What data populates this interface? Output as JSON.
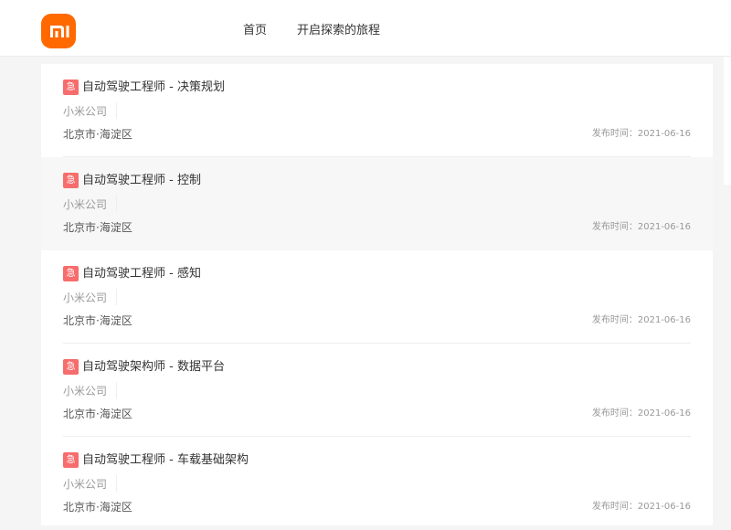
{
  "header": {
    "logo_text": "mi",
    "nav": [
      {
        "label": "首页"
      },
      {
        "label": "开启探索的旅程"
      }
    ]
  },
  "colors": {
    "brand": "#ff6900",
    "urgent_badge": "#f76c6c"
  },
  "jobs": [
    {
      "badge": "急",
      "title": "自动驾驶工程师 - 决策规划",
      "company": "小米公司",
      "location": "北京市·海淀区",
      "date_label": "发布时间：",
      "date": "2021-06-16"
    },
    {
      "badge": "急",
      "title": "自动驾驶工程师 - 控制",
      "company": "小米公司",
      "location": "北京市·海淀区",
      "date_label": "发布时间：",
      "date": "2021-06-16"
    },
    {
      "badge": "急",
      "title": "自动驾驶工程师 - 感知",
      "company": "小米公司",
      "location": "北京市·海淀区",
      "date_label": "发布时间：",
      "date": "2021-06-16"
    },
    {
      "badge": "急",
      "title": "自动驾驶架构师 - 数据平台",
      "company": "小米公司",
      "location": "北京市·海淀区",
      "date_label": "发布时间：",
      "date": "2021-06-16"
    },
    {
      "badge": "急",
      "title": "自动驾驶工程师 - 车载基础架构",
      "company": "小米公司",
      "location": "北京市·海淀区",
      "date_label": "发布时间：",
      "date": "2021-06-16"
    }
  ]
}
